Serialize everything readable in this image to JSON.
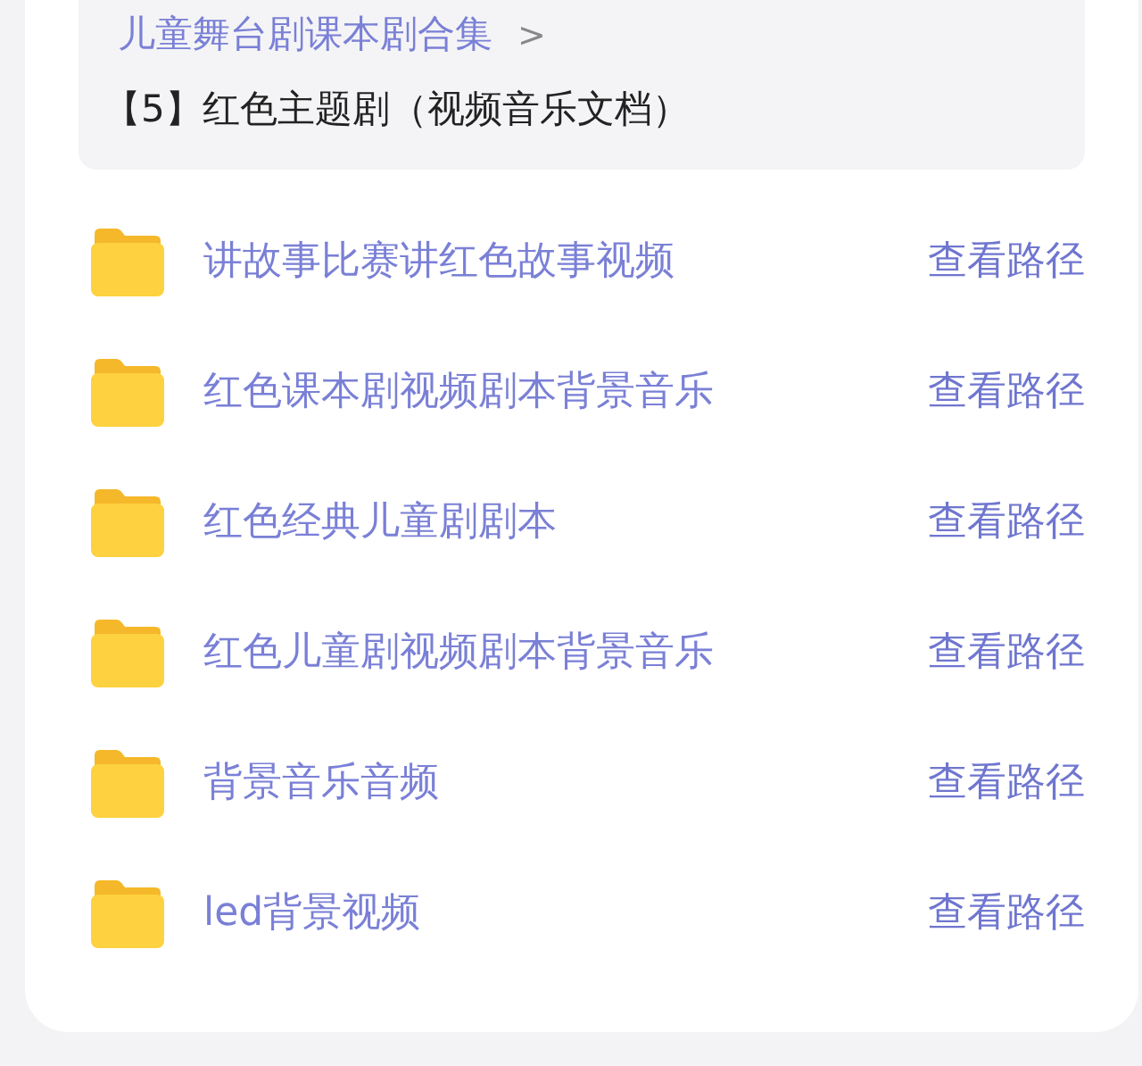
{
  "breadcrumb": {
    "parent": "儿童舞台剧课本剧合集",
    "separator": ">",
    "current": "【5】红色主题剧（视频音乐文档）"
  },
  "folders": [
    {
      "name": "讲故事比赛讲红色故事视频",
      "action": "查看路径"
    },
    {
      "name": "红色课本剧视频剧本背景音乐",
      "action": "查看路径"
    },
    {
      "name": "红色经典儿童剧剧本",
      "action": "查看路径"
    },
    {
      "name": "红色儿童剧视频剧本背景音乐",
      "action": "查看路径"
    },
    {
      "name": "背景音乐音频",
      "action": "查看路径"
    },
    {
      "name": "led背景视频",
      "action": "查看路径"
    }
  ]
}
